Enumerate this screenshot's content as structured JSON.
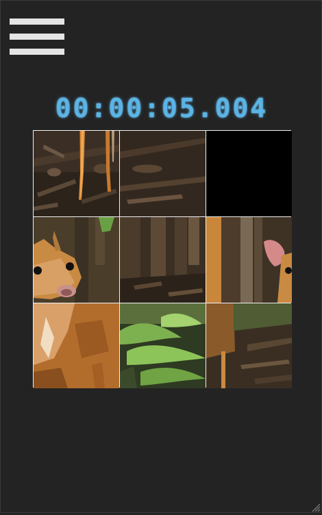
{
  "game": {
    "timer": "00:00:05.004",
    "tiles": [
      {
        "slot": 1,
        "image": "deer-legs-on-forest-floor"
      },
      {
        "slot": 2,
        "image": "deer-legs-left-part"
      },
      {
        "slot": 3,
        "image": "empty"
      },
      {
        "slot": 4,
        "image": "deer-face"
      },
      {
        "slot": 5,
        "image": "forest-tree-trunks"
      },
      {
        "slot": 6,
        "image": "deer-ear-and-trunks"
      },
      {
        "slot": 7,
        "image": "deer-chest"
      },
      {
        "slot": 8,
        "image": "green-leaves"
      },
      {
        "slot": 9,
        "image": "deer-hind-leg"
      }
    ]
  },
  "colors": {
    "background": "#232323",
    "timer": "#5ab4e6",
    "empty_tile": "#000000",
    "board_grid": "#f2f2f2"
  },
  "icons": {
    "menu": "hamburger-menu-icon",
    "resize": "resize-grip-icon"
  }
}
